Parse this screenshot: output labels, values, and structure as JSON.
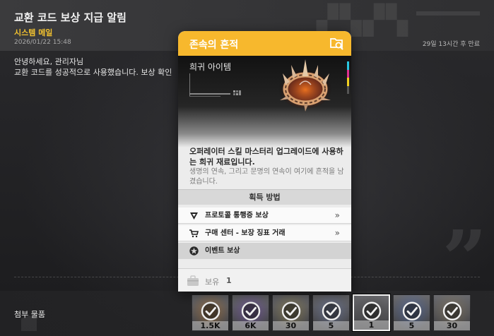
{
  "mail": {
    "title": "교환 코드 보상 지급 알림",
    "sender": "시스템 메일",
    "date": "2026/01/22 15:48",
    "expire": "29일 13시간 후 만료",
    "greeting": "안녕하세요, 관리자님",
    "body": "교환 코드를 성공적으로 사용했습니다. 보상 확인",
    "attach_label": "첨부 물품",
    "quote_glyph": "”"
  },
  "popup": {
    "item_name": "존속의 흔적",
    "rarity": "희귀 아이템",
    "description": "오퍼레이터 스킬 마스터리 업그레이드에 사용하는 희귀 재료입니다.",
    "flavor": "생명의 연속, 그리고 문명의 연속이 여기에 흔적을 남겼습니다.",
    "acquire_header": "획득 방법",
    "acquire": [
      {
        "label": "프로토콜 통행증 보상",
        "icon": "protocol-pass-icon",
        "chevron": "»"
      },
      {
        "label": "구매 센터 - 보장 징표 거래",
        "icon": "shop-cart-icon",
        "chevron": "»"
      },
      {
        "label": "이벤트 보상",
        "icon": "event-star-icon",
        "chevron": ""
      }
    ],
    "own_label": "보유",
    "own_count": "1"
  },
  "attachments": [
    {
      "qty": "1.5K",
      "tint": "#b8752a",
      "claimed": true
    },
    {
      "qty": "6K",
      "tint": "#7a4fb8",
      "claimed": true
    },
    {
      "qty": "30",
      "tint": "#9a8a4a",
      "claimed": true
    },
    {
      "qty": "5",
      "tint": "#6a7aa8",
      "claimed": true
    },
    {
      "qty": "1",
      "tint": "#4a4a4a",
      "claimed": true
    },
    {
      "qty": "5",
      "tint": "#4a6ab0",
      "claimed": true
    },
    {
      "qty": "30",
      "tint": "#8a7a5a",
      "claimed": true
    }
  ],
  "colors": {
    "accent": "#f7b82d",
    "sender": "#f2c230"
  }
}
